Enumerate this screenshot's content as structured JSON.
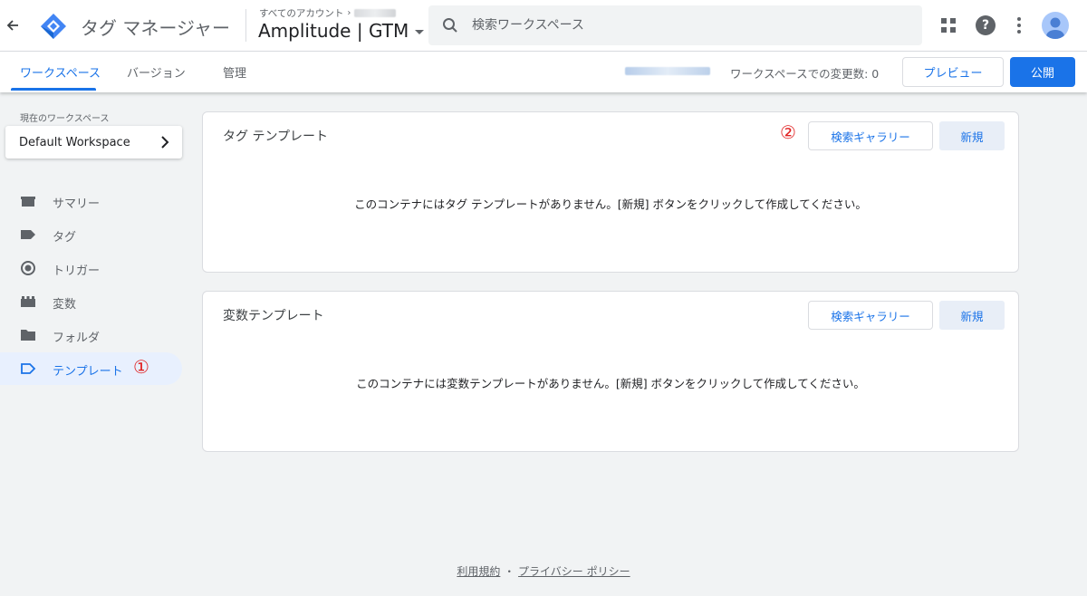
{
  "header": {
    "app_title": "タグ マネージャー",
    "account_crumb": "すべてのアカウント",
    "container_name": "Amplitude | GTM",
    "search_placeholder": "検索ワークスペース"
  },
  "subnav": {
    "tabs": [
      {
        "label": "ワークスペース",
        "active": true
      },
      {
        "label": "バージョン",
        "active": false
      },
      {
        "label": "管理",
        "active": false
      }
    ],
    "workspace_changes": "ワークスペースでの変更数: 0",
    "preview_label": "プレビュー",
    "publish_label": "公開"
  },
  "sidebar": {
    "current_workspace_label": "現在のワークスペース",
    "workspace_name": "Default Workspace",
    "items": [
      {
        "label": "サマリー",
        "icon": "summary-icon"
      },
      {
        "label": "タグ",
        "icon": "tag-icon"
      },
      {
        "label": "トリガー",
        "icon": "trigger-icon"
      },
      {
        "label": "変数",
        "icon": "variable-icon"
      },
      {
        "label": "フォルダ",
        "icon": "folder-icon"
      },
      {
        "label": "テンプレート",
        "icon": "template-icon",
        "active": true
      }
    ],
    "annotation": "①"
  },
  "tag_templates": {
    "title": "タグ テンプレート",
    "gallery_label": "検索ギャラリー",
    "new_label": "新規",
    "empty_message": "このコンテナにはタグ テンプレートがありません。[新規] ボタンをクリックして作成してください。",
    "annotation": "②"
  },
  "variable_templates": {
    "title": "変数テンプレート",
    "gallery_label": "検索ギャラリー",
    "new_label": "新規",
    "empty_message": "このコンテナには変数テンプレートがありません。[新規] ボタンをクリックして作成してください。"
  },
  "footer": {
    "terms": "利用規約",
    "separator": "・",
    "privacy": "プライバシー ポリシー"
  },
  "colors": {
    "accent": "#1a73e8",
    "annotation": "#e02020",
    "background": "#f1f3f4"
  }
}
